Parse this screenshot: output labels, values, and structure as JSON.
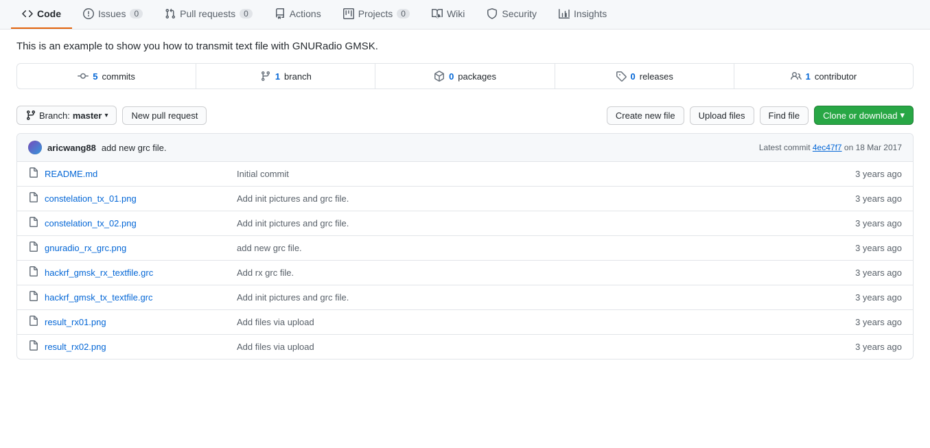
{
  "tabs": [
    {
      "id": "code",
      "label": "Code",
      "icon": "code",
      "badge": null,
      "active": true
    },
    {
      "id": "issues",
      "label": "Issues",
      "icon": "issue",
      "badge": "0",
      "active": false
    },
    {
      "id": "pull-requests",
      "label": "Pull requests",
      "icon": "pr",
      "badge": "0",
      "active": false
    },
    {
      "id": "actions",
      "label": "Actions",
      "icon": "actions",
      "badge": null,
      "active": false
    },
    {
      "id": "projects",
      "label": "Projects",
      "icon": "projects",
      "badge": "0",
      "active": false
    },
    {
      "id": "wiki",
      "label": "Wiki",
      "icon": "wiki",
      "badge": null,
      "active": false
    },
    {
      "id": "security",
      "label": "Security",
      "icon": "security",
      "badge": null,
      "active": false
    },
    {
      "id": "insights",
      "label": "Insights",
      "icon": "insights",
      "badge": null,
      "active": false
    }
  ],
  "repo_description": "This is an example to show you how to transmit text file with GNURadio GMSK.",
  "stats": [
    {
      "id": "commits",
      "icon": "commit",
      "count": "5",
      "label": "commits"
    },
    {
      "id": "branch",
      "icon": "branch",
      "count": "1",
      "label": "branch"
    },
    {
      "id": "packages",
      "icon": "package",
      "count": "0",
      "label": "packages"
    },
    {
      "id": "releases",
      "icon": "tag",
      "count": "0",
      "label": "releases"
    },
    {
      "id": "contributors",
      "icon": "people",
      "count": "1",
      "label": "contributor"
    }
  ],
  "branch_selector": {
    "label": "Branch:",
    "current": "master"
  },
  "buttons": {
    "new_pull_request": "New pull request",
    "create_new_file": "Create new file",
    "upload_files": "Upload files",
    "find_file": "Find file",
    "clone_or_download": "Clone or download"
  },
  "commit_header": {
    "author": "aricwang88",
    "message": "add new grc file.",
    "hash": "4ec47f7",
    "date": "18 Mar 2017",
    "full_text": "Latest commit 4ec47f7 on 18 Mar 2017"
  },
  "files": [
    {
      "name": "README.md",
      "commit_msg": "Initial commit",
      "age": "3 years ago"
    },
    {
      "name": "constelation_tx_01.png",
      "commit_msg": "Add init pictures and grc file.",
      "age": "3 years ago"
    },
    {
      "name": "constelation_tx_02.png",
      "commit_msg": "Add init pictures and grc file.",
      "age": "3 years ago"
    },
    {
      "name": "gnuradio_rx_grc.png",
      "commit_msg": "add new grc file.",
      "age": "3 years ago"
    },
    {
      "name": "hackrf_gmsk_rx_textfile.grc",
      "commit_msg": "Add rx grc file.",
      "age": "3 years ago"
    },
    {
      "name": "hackrf_gmsk_tx_textfile.grc",
      "commit_msg": "Add init pictures and grc file.",
      "age": "3 years ago"
    },
    {
      "name": "result_rx01.png",
      "commit_msg": "Add files via upload",
      "age": "3 years ago"
    },
    {
      "name": "result_rx02.png",
      "commit_msg": "Add files via upload",
      "age": "3 years ago"
    }
  ]
}
